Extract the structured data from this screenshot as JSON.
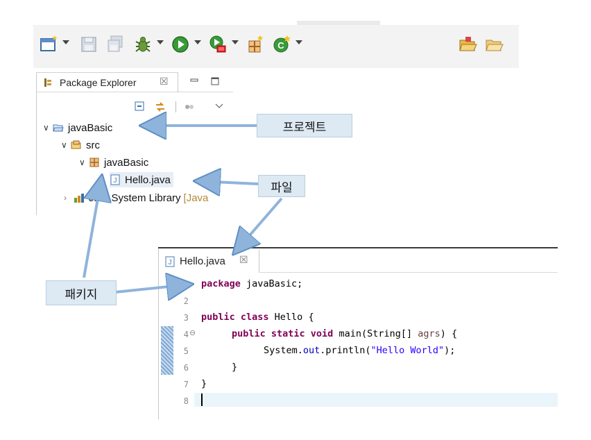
{
  "explorer": {
    "title": "Package Explorer",
    "close_glyph": "☒",
    "tree": [
      {
        "label": "javaBasic"
      },
      {
        "label": "src"
      },
      {
        "label": "javaBasic"
      },
      {
        "label": "Hello.java"
      },
      {
        "label": "JRE System Library",
        "suffix": "[Java"
      }
    ]
  },
  "editor": {
    "tab_label": "Hello.java",
    "close_glyph": "☒",
    "line_numbers": [
      "1",
      "2",
      "3",
      "4",
      "5",
      "6",
      "7",
      "8"
    ],
    "fold_marker": "⊖",
    "code": {
      "l1_kw": "package",
      "l1_rest": " javaBasic;",
      "l3_kw": "public class",
      "l3_rest": " Hello {",
      "l4_kw1": "public static void",
      "l4_mid": " main(String[] ",
      "l4_param": "agrs",
      "l4_end": ") {",
      "l5_a": "System.",
      "l5_field": "out",
      "l5_b": ".println(",
      "l5_str": "\"Hello World\"",
      "l5_c": ");",
      "l6": "}",
      "l7": "}"
    }
  },
  "callouts": {
    "project": "프로젝트",
    "file": "파일",
    "package": "패키지"
  },
  "colors": {
    "keyword": "#7f0055",
    "string": "#2a00ff",
    "field": "#0000c0",
    "callout_bg": "#dde9f3",
    "arrow": "#8fb4dc"
  },
  "toolbar_icons": [
    "new-wizard-icon",
    "save-icon",
    "save-all-icon",
    "debug-icon",
    "run-icon",
    "run-external-icon",
    "new-package-icon",
    "new-class-icon",
    "open-folder-icon",
    "open-folder-alt-icon"
  ]
}
